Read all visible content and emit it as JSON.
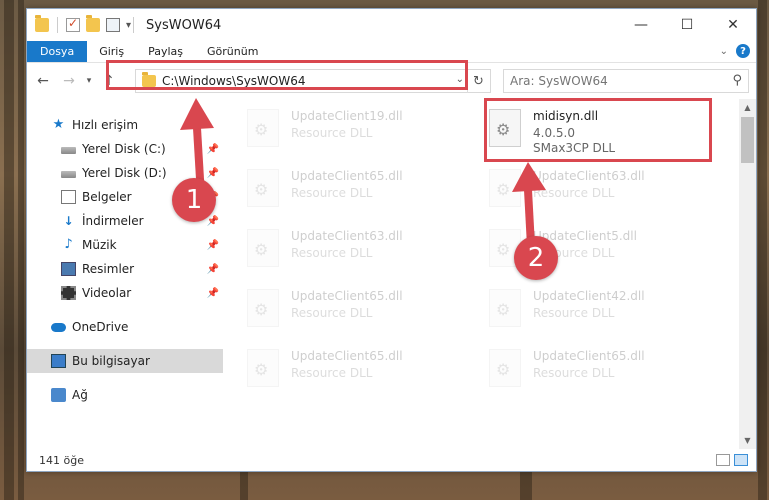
{
  "window": {
    "title": "SysWOW64",
    "controls": {
      "minimize": "—",
      "maximize": "☐",
      "close": "✕"
    }
  },
  "ribbon": {
    "tabs": [
      "Dosya",
      "Giriş",
      "Paylaş",
      "Görünüm"
    ]
  },
  "address": {
    "path": "C:\\Windows\\SysWOW64",
    "search_placeholder": "Ara: SysWOW64"
  },
  "navigation": {
    "items": [
      {
        "label": "Hızlı erişim",
        "icon": "star-icon"
      },
      {
        "label": "Yerel Disk (C:)",
        "icon": "disk-icon",
        "pinned": true
      },
      {
        "label": "Yerel Disk (D:)",
        "icon": "disk-icon",
        "pinned": true
      },
      {
        "label": "Belgeler",
        "icon": "document-icon",
        "pinned": true
      },
      {
        "label": "İndirmeler",
        "icon": "download-icon",
        "pinned": true
      },
      {
        "label": "Müzik",
        "icon": "music-icon",
        "pinned": true
      },
      {
        "label": "Resimler",
        "icon": "pictures-icon",
        "pinned": true
      },
      {
        "label": "Videolar",
        "icon": "videos-icon",
        "pinned": true
      },
      {
        "label": "OneDrive",
        "icon": "cloud-icon"
      },
      {
        "label": "Bu bilgisayar",
        "icon": "computer-icon",
        "selected": true
      },
      {
        "label": "Ağ",
        "icon": "network-icon"
      }
    ]
  },
  "files": [
    {
      "name": "UpdateClient19.dll",
      "desc": "Resource DLL"
    },
    {
      "name": "midisyn.dll",
      "desc": "4.0.5.0",
      "desc2": "SMax3CP DLL"
    },
    {
      "name": "UpdateClient65.dll",
      "desc": "Resource DLL"
    },
    {
      "name": "UpdateClient63.dll",
      "desc": "Resource DLL"
    },
    {
      "name": "UpdateClient63.dll",
      "desc": "Resource DLL"
    },
    {
      "name": "UpdateClient5.dll",
      "desc": "Resource DLL"
    },
    {
      "name": "UpdateClient65.dll",
      "desc": "Resource DLL"
    },
    {
      "name": "UpdateClient42.dll",
      "desc": "Resource DLL"
    },
    {
      "name": "UpdateClient65.dll",
      "desc": "Resource DLL"
    },
    {
      "name": "UpdateClient65.dll",
      "desc": "Resource DLL"
    }
  ],
  "status": {
    "count": "141 öğe"
  },
  "callouts": [
    "1",
    "2"
  ],
  "colors": {
    "accent": "#1979ca",
    "highlight": "#d9474f"
  }
}
